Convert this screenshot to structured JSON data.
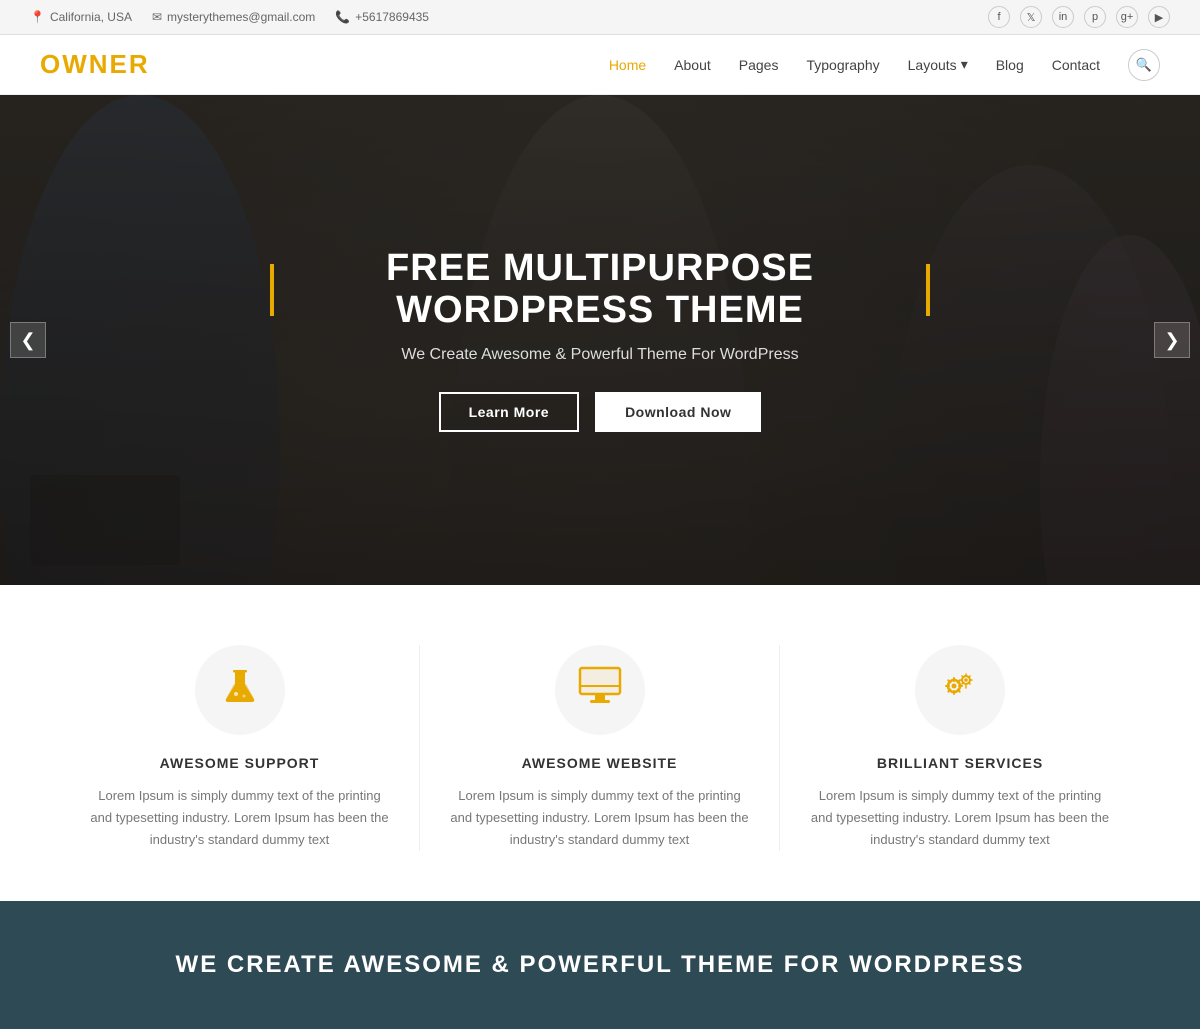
{
  "topbar": {
    "location": "California, USA",
    "email": "mysterythemes@gmail.com",
    "phone": "+5617869435",
    "location_icon": "📍",
    "email_icon": "✉",
    "phone_icon": "📞",
    "socials": [
      "f",
      "t",
      "in",
      "p",
      "g+",
      "▶"
    ]
  },
  "header": {
    "logo_main": "OWN",
    "logo_accent": "ER",
    "nav": [
      {
        "label": "Home",
        "active": true
      },
      {
        "label": "About",
        "active": false
      },
      {
        "label": "Pages",
        "active": false
      },
      {
        "label": "Typography",
        "active": false
      },
      {
        "label": "Layouts",
        "active": false,
        "has_dropdown": true
      },
      {
        "label": "Blog",
        "active": false
      },
      {
        "label": "Contact",
        "active": false
      }
    ]
  },
  "hero": {
    "title": "FREE MULTIPURPOSE WORDPRESS THEME",
    "subtitle": "We Create Awesome & Powerful Theme For WordPress",
    "btn_learn": "Learn More",
    "btn_download": "Download Now",
    "arrow_left": "❮",
    "arrow_right": "❯"
  },
  "features": [
    {
      "icon_name": "flask-icon",
      "icon_char": "⚗",
      "title": "AWESOME SUPPORT",
      "text": "Lorem Ipsum is simply dummy text of the printing and typesetting industry. Lorem Ipsum has been the industry's standard dummy text"
    },
    {
      "icon_name": "monitor-icon",
      "icon_char": "🖥",
      "title": "AWESOME WEBSITE",
      "text": "Lorem Ipsum is simply dummy text of the printing and typesetting industry. Lorem Ipsum has been the industry's standard dummy text"
    },
    {
      "icon_name": "gear-icon",
      "icon_char": "⚙",
      "title": "BRILLIANT SERVICES",
      "text": "Lorem Ipsum is simply dummy text of the printing and typesetting industry. Lorem Ipsum has been the industry's standard dummy text"
    }
  ],
  "cta": {
    "title": "WE CREATE AWESOME & POWERFUL THEME FOR WORDPRESS"
  },
  "colors": {
    "accent": "#e8a900",
    "dark_bg": "#2d4a55"
  }
}
